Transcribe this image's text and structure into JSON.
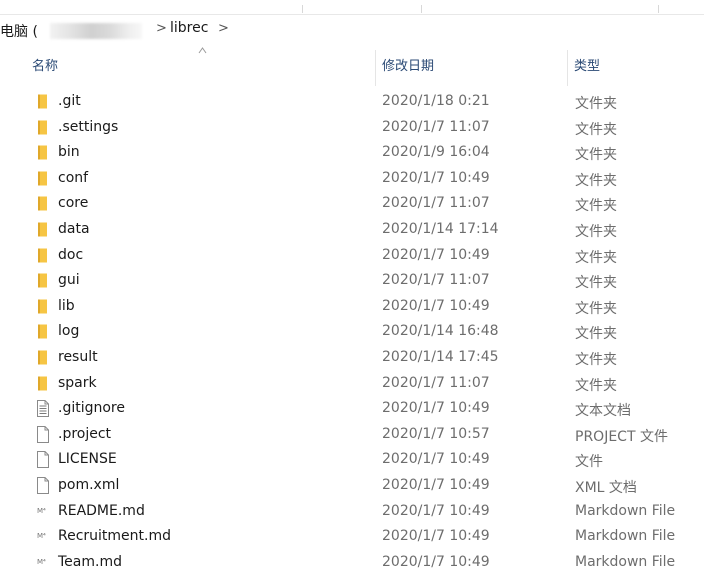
{
  "breadcrumb": {
    "root_label": "电脑 (",
    "separator": ">",
    "current_folder": "librec"
  },
  "columns": {
    "name": "名称",
    "date": "修改日期",
    "type": "类型"
  },
  "colors": {
    "folder": "#f6c544",
    "header_text": "#2b4a75",
    "muted_text": "#6d6d6d"
  },
  "files": [
    {
      "name": ".git",
      "date": "2020/1/18 0:21",
      "type": "文件夹",
      "icon": "folder-icon"
    },
    {
      "name": ".settings",
      "date": "2020/1/7 11:07",
      "type": "文件夹",
      "icon": "folder-icon"
    },
    {
      "name": "bin",
      "date": "2020/1/9 16:04",
      "type": "文件夹",
      "icon": "folder-icon"
    },
    {
      "name": "conf",
      "date": "2020/1/7 10:49",
      "type": "文件夹",
      "icon": "folder-icon"
    },
    {
      "name": "core",
      "date": "2020/1/7 11:07",
      "type": "文件夹",
      "icon": "folder-icon"
    },
    {
      "name": "data",
      "date": "2020/1/14 17:14",
      "type": "文件夹",
      "icon": "folder-icon"
    },
    {
      "name": "doc",
      "date": "2020/1/7 10:49",
      "type": "文件夹",
      "icon": "folder-icon"
    },
    {
      "name": "gui",
      "date": "2020/1/7 11:07",
      "type": "文件夹",
      "icon": "folder-icon"
    },
    {
      "name": "lib",
      "date": "2020/1/7 10:49",
      "type": "文件夹",
      "icon": "folder-icon"
    },
    {
      "name": "log",
      "date": "2020/1/14 16:48",
      "type": "文件夹",
      "icon": "folder-icon"
    },
    {
      "name": "result",
      "date": "2020/1/14 17:45",
      "type": "文件夹",
      "icon": "folder-icon"
    },
    {
      "name": "spark",
      "date": "2020/1/7 11:07",
      "type": "文件夹",
      "icon": "folder-icon"
    },
    {
      "name": ".gitignore",
      "date": "2020/1/7 10:49",
      "type": "文本文档",
      "icon": "text-file-icon"
    },
    {
      "name": ".project",
      "date": "2020/1/7 10:57",
      "type": "PROJECT 文件",
      "icon": "file-icon"
    },
    {
      "name": "LICENSE",
      "date": "2020/1/7 10:49",
      "type": "文件",
      "icon": "file-icon"
    },
    {
      "name": "pom.xml",
      "date": "2020/1/7 10:49",
      "type": "XML 文档",
      "icon": "file-icon"
    },
    {
      "name": "README.md",
      "date": "2020/1/7 10:49",
      "type": "Markdown File",
      "icon": "markdown-file-icon"
    },
    {
      "name": "Recruitment.md",
      "date": "2020/1/7 10:49",
      "type": "Markdown File",
      "icon": "markdown-file-icon"
    },
    {
      "name": "Team.md",
      "date": "2020/1/7 10:49",
      "type": "Markdown File",
      "icon": "markdown-file-icon"
    }
  ]
}
